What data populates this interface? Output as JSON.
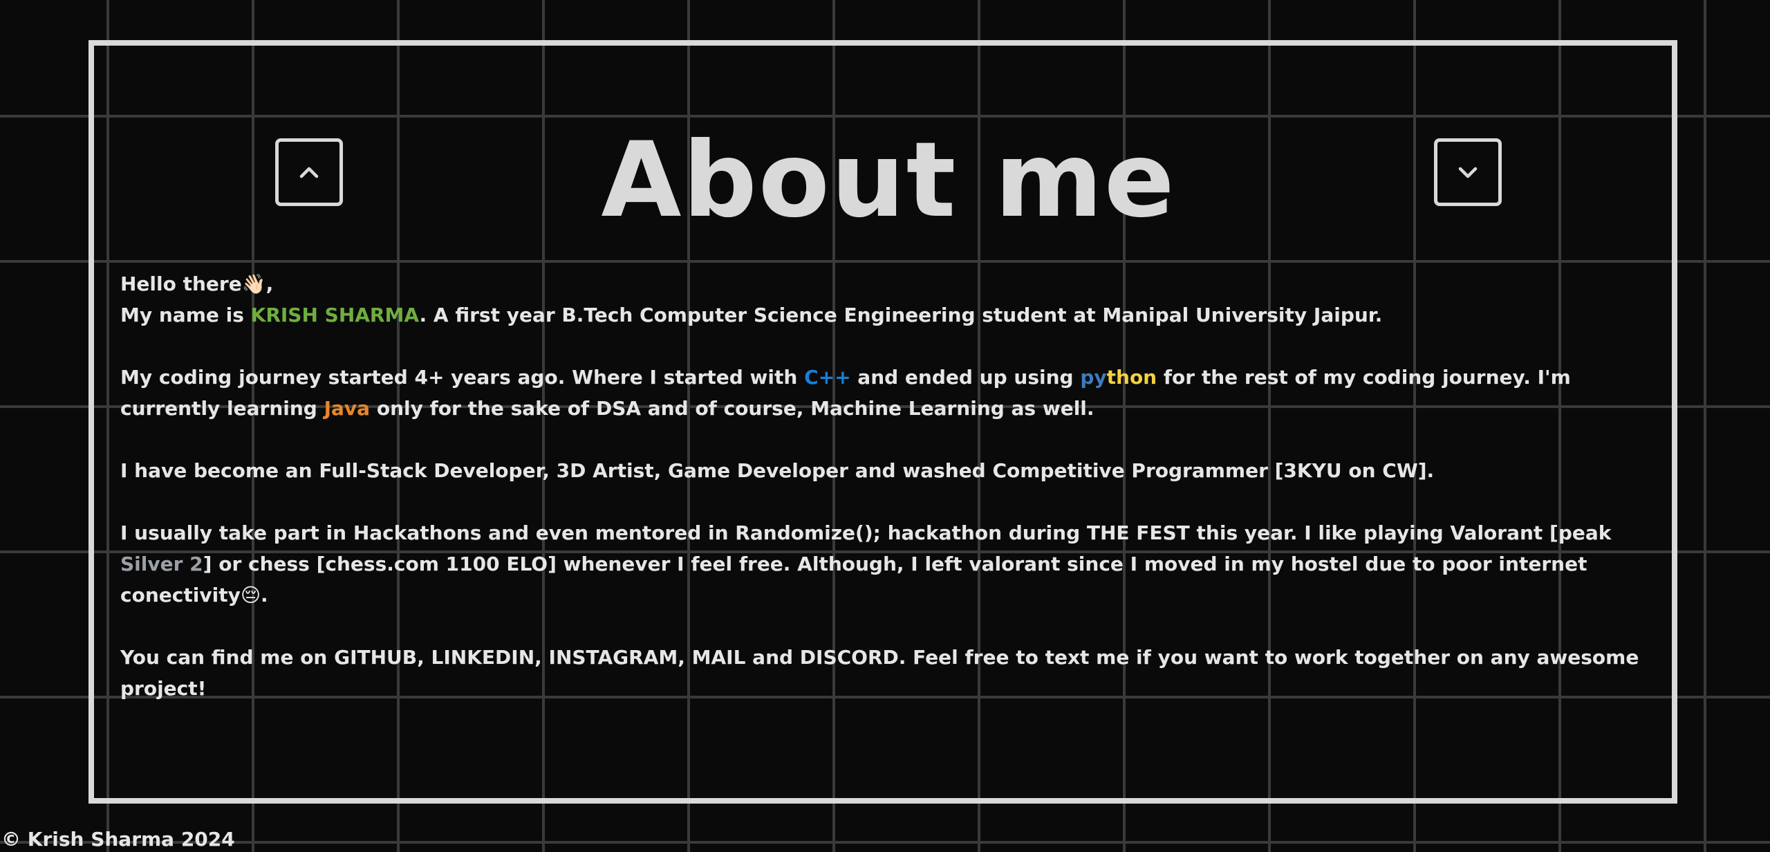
{
  "section": {
    "title": "About me",
    "nav": {
      "up_icon": "chevron-up-icon",
      "down_icon": "chevron-down-icon"
    }
  },
  "about": {
    "greeting": "Hello there",
    "greeting_emoji": "👋🏻",
    "greeting_suffix": ",",
    "intro_prefix": "My name is ",
    "name": "KRISH SHARMA",
    "intro_suffix": ". A first year B.Tech Computer Science Engineering student at Manipal University Jaipur.",
    "coding_p1": "My coding journey started 4+ years ago. Where I started with ",
    "cpp": "C++",
    "coding_p2": " and ended up using ",
    "py_a": "py",
    "py_b": "thon",
    "coding_p3": " for the rest of my coding journey. I'm currently learning ",
    "java": "Java",
    "coding_p4": " only for the sake of DSA and of course, Machine Learning as well.",
    "roles": "I have become an Full-Stack Developer, 3D Artist, Game Developer and washed Competitive Programmer [3KYU on CW].",
    "hack_p1": "I usually take part in Hackathons and even mentored in Randomize(); hackathon during THE FEST this year. I like playing Valorant [peak ",
    "silver": "Silver 2",
    "hack_p2": "] or chess [chess.com 1100 ELO] whenever I feel free. Although, I left valorant since I moved in my hostel due to poor internet conectivity",
    "hack_emoji": "😔",
    "hack_p3": ".",
    "contact_prefix": "You can find me on ",
    "github": "GITHUB",
    "sep1": ", ",
    "linkedin": "LINKEDIN",
    "sep2": ", ",
    "instagram": "INSTAGRAM",
    "sep3": ", ",
    "mail": "MAIL",
    "sep4": " and ",
    "discord": "DISCORD",
    "contact_suffix": ". Feel free to text me if you want to work together on any awesome project!"
  },
  "footer": {
    "text": "© Krish Sharma 2024"
  },
  "colors": {
    "background": "#0a0a0a",
    "grid": "#3a3a3a",
    "border": "#d9d9d9",
    "name": "#6fae3f",
    "cpp": "#1a7fd6",
    "python_blue": "#3d7bbf",
    "python_yellow": "#f5d142",
    "java": "#e8862a",
    "silver": "#9aa0a6"
  }
}
